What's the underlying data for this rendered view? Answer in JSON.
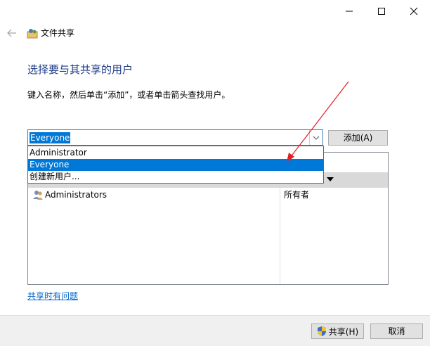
{
  "window": {
    "minimize_icon": "minimize-icon",
    "maximize_icon": "maximize-icon",
    "close_icon": "close-icon"
  },
  "wizard": {
    "back_icon": "back-arrow-icon",
    "title": "文件共享"
  },
  "main": {
    "heading": "选择要与其共享的用户",
    "instruction": "键入名称，然后单击“添加”，或者单击箭头查找用户。",
    "combo_value": "Everyone",
    "add_button": "添加(A)",
    "dropdown_items": [
      "Administrator",
      "Everyone",
      "创建新用户..."
    ],
    "dropdown_selected_index": 1,
    "list_rows": [
      {
        "name": "Administrators",
        "permission": "所有者",
        "icon": "user-group-icon"
      }
    ],
    "help_link": "共享时有问题"
  },
  "footer": {
    "share_button": "共享(H)",
    "share_icon": "uac-shield-icon",
    "cancel_button": "取消"
  },
  "colors": {
    "heading": "#1e3b86",
    "selection": "#0078d7",
    "link": "#0066cc",
    "annotation_arrow": "#e02020"
  }
}
